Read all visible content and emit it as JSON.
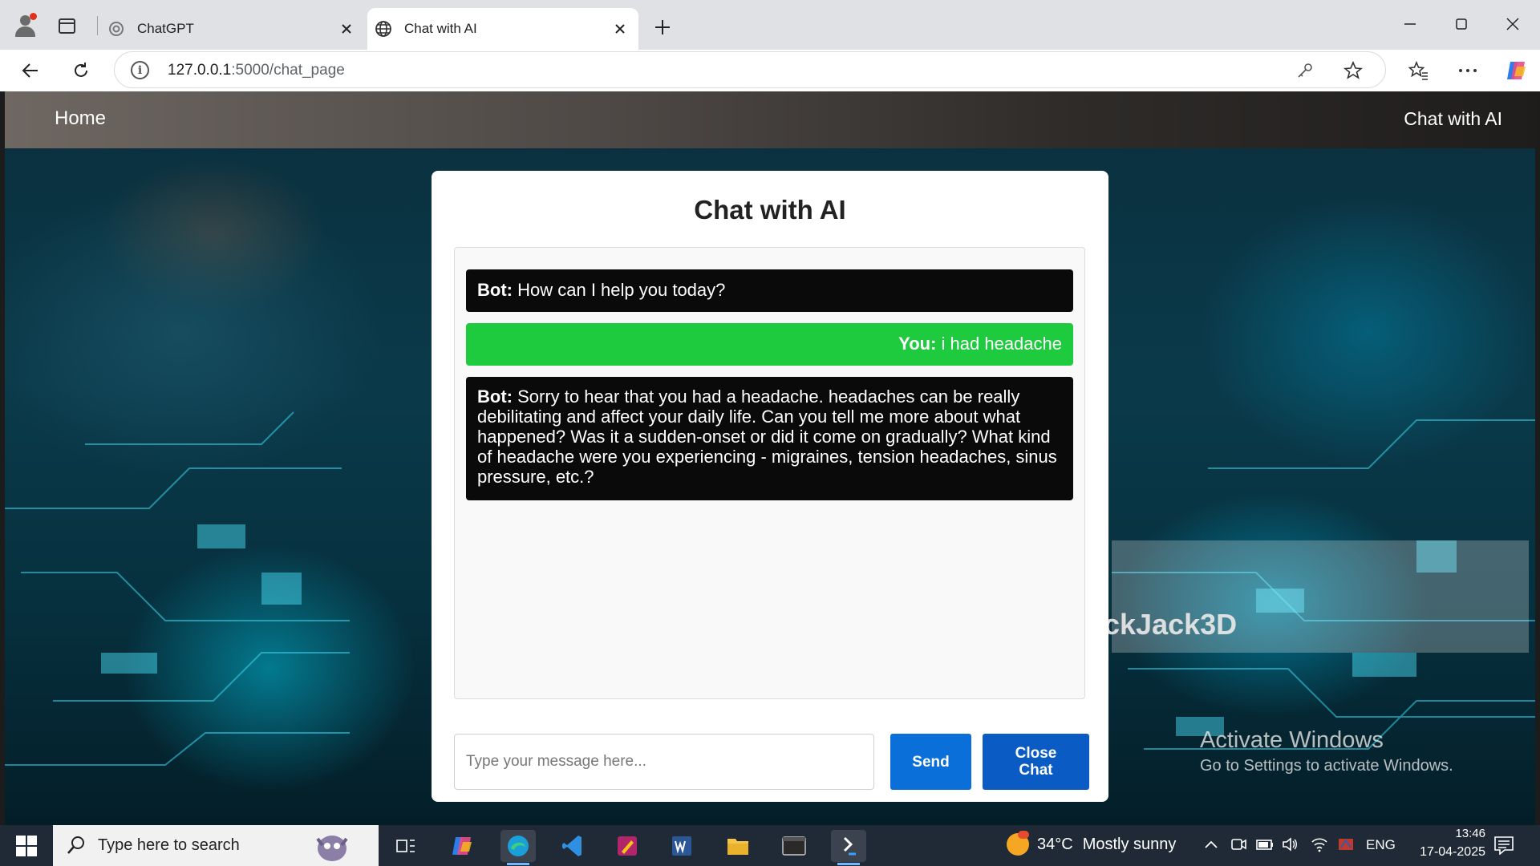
{
  "browser": {
    "tabs": [
      {
        "label": "ChatGPT",
        "icon": "chatgpt-icon",
        "active": false
      },
      {
        "label": "Chat with AI",
        "icon": "globe-icon",
        "active": true
      }
    ],
    "url_host": "127.0.0.1",
    "url_path": ":5000/chat_page"
  },
  "page": {
    "nav_home": "Home",
    "nav_right": "Chat with AI",
    "card_title": "Chat with AI",
    "messages": [
      {
        "sender": "Bot:",
        "text": "How can I help you today?",
        "role": "bot"
      },
      {
        "sender": "You:",
        "text": "i had headache",
        "role": "user"
      },
      {
        "sender": "Bot:",
        "text": "Sorry to hear that you had a headache. headaches can be really debilitating and affect your daily life. Can you tell me more about what happened? Was it a sudden-onset or did it come on gradually? What kind of headache were you experiencing - migraines, tension headaches, sinus pressure, etc.?",
        "role": "bot"
      }
    ],
    "input_placeholder": "Type your message here...",
    "send_label": "Send",
    "close_label": "Close Chat",
    "background_watermark": "ckJack3D",
    "activation_title": "Activate Windows",
    "activation_sub": "Go to Settings to activate Windows."
  },
  "taskbar": {
    "search_placeholder": "Type here to search",
    "weather_temp": "34°C",
    "weather_desc": "Mostly sunny",
    "language": "ENG",
    "time": "13:46",
    "date": "17-04-2025"
  },
  "colors": {
    "bot_bubble": "#0a0a0a",
    "user_bubble": "#1ecb3e",
    "send_button": "#0a6fd8",
    "close_button": "#0a5cc4"
  }
}
